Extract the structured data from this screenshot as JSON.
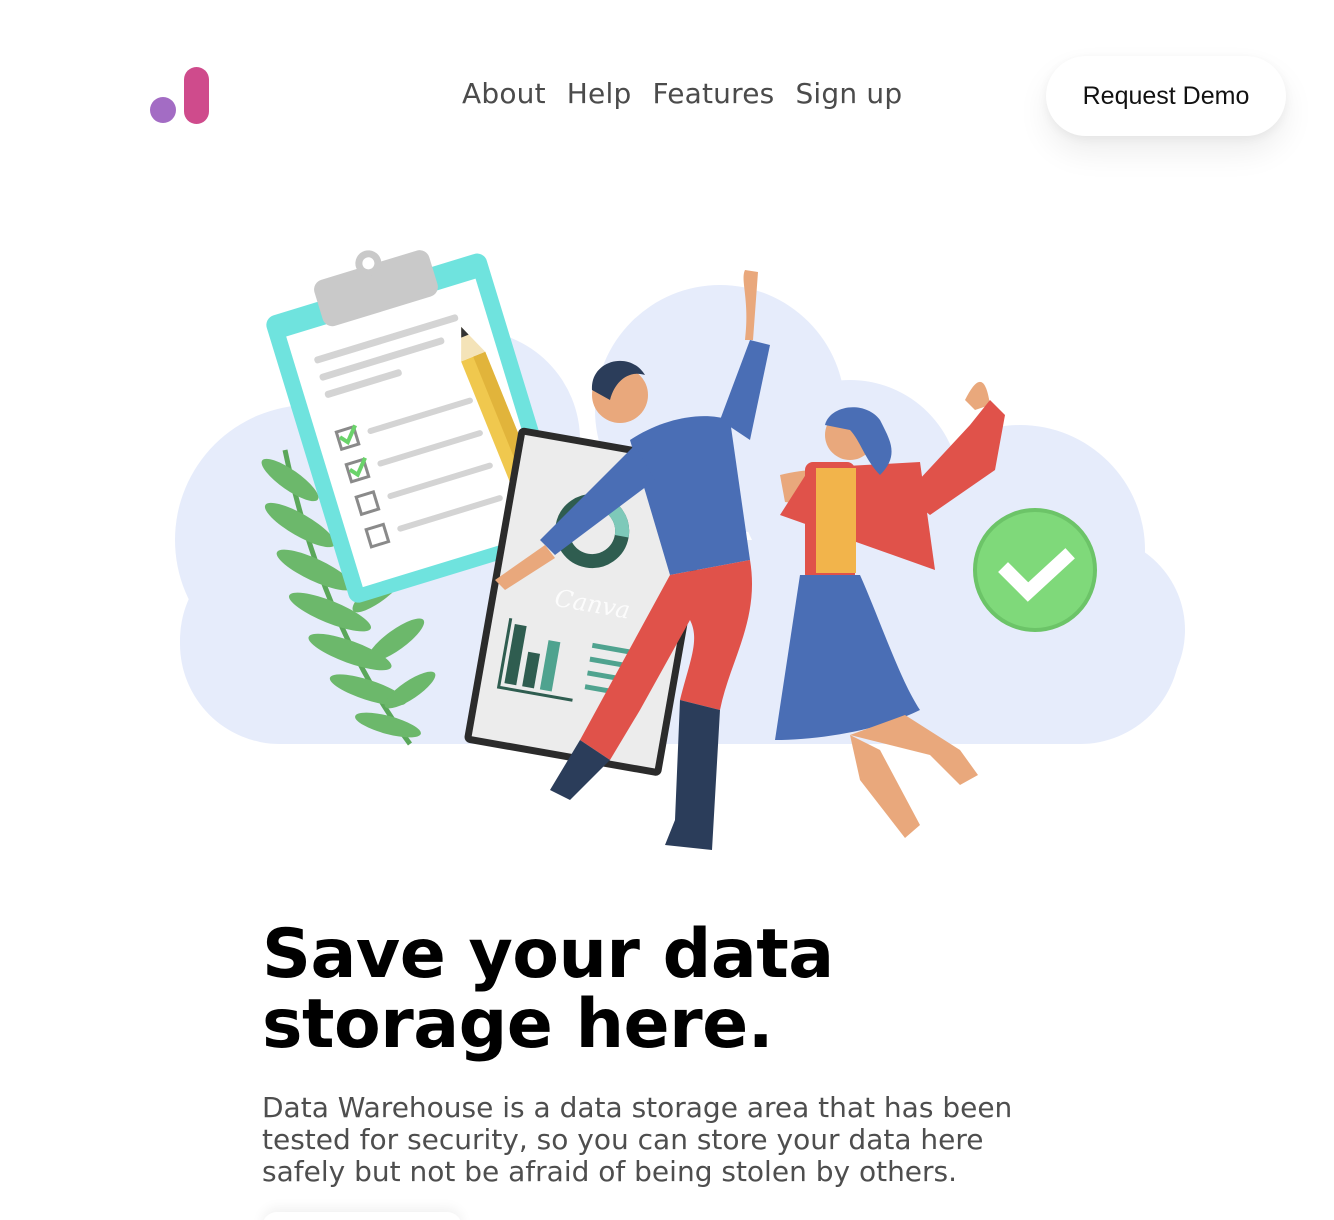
{
  "brand": {
    "logo_icon": "bar-logo-icon",
    "colors": {
      "dot": "#a36cc4",
      "bar": "#cf4b8c"
    }
  },
  "nav": {
    "items": [
      {
        "label": "About"
      },
      {
        "label": "Help"
      },
      {
        "label": "Features"
      },
      {
        "label": "Sign up"
      }
    ]
  },
  "header": {
    "cta_label": "Request Demo"
  },
  "hero": {
    "illustration": "people-celebrating-data-illustration",
    "poster_text": "Canva",
    "headline": "Save your data storage here.",
    "description": "Data Warehouse is a data storage area that has been tested for security, so you can store your data here safely but not be afraid of being stolen by others."
  },
  "colors": {
    "cloud": "#e6ecfb",
    "clipboard": "#6fe3de",
    "check_badge": "#7fd97a",
    "shirt": "#4a6eb5",
    "pants": "#e0524a",
    "skirt": "#4a6eb5",
    "jacket": "#e0524a",
    "skin": "#e9a87c"
  }
}
